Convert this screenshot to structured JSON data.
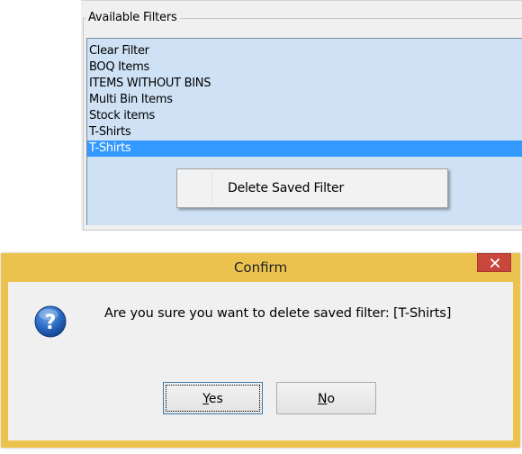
{
  "filters": {
    "group_label": "Available Filters",
    "items": [
      {
        "label": "Clear Filter"
      },
      {
        "label": "BOQ Items"
      },
      {
        "label": "ITEMS WITHOUT BINS"
      },
      {
        "label": "Multi Bin Items"
      },
      {
        "label": "Stock items"
      },
      {
        "label": "T-Shirts"
      },
      {
        "label": "T-Shirts",
        "selected": true
      }
    ]
  },
  "context_menu": {
    "items": [
      {
        "label": "Delete Saved Filter"
      }
    ]
  },
  "dialog": {
    "title": "Confirm",
    "message": "Are you sure you want to delete saved filter: [T-Shirts]",
    "icon": "question-icon",
    "buttons": {
      "yes": {
        "mnemonic": "Y",
        "rest": "es"
      },
      "no": {
        "mnemonic": "N",
        "rest": "o"
      }
    }
  },
  "colors": {
    "title_bar": "#ecc24f",
    "close_button": "#c9463d",
    "selection": "#3399ff",
    "list_background": "#cfe2f5",
    "question_icon": "#1a5fb4"
  }
}
